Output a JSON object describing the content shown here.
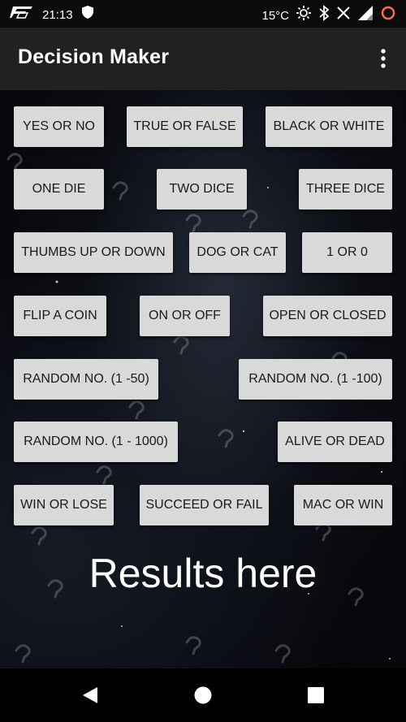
{
  "status_bar": {
    "time": "21:13",
    "temperature": "15°C",
    "icons": [
      "app-notification-icon",
      "shield-icon",
      "brightness-icon",
      "bluetooth-icon",
      "mute-icon",
      "signal-icon",
      "sync-icon"
    ]
  },
  "app_bar": {
    "title": "Decision Maker",
    "overflow_icon": "more-vert-icon"
  },
  "buttons": {
    "yes_no": "YES OR NO",
    "true_false": "TRUE OR FALSE",
    "black_white": "BLACK OR WHITE",
    "one_die": "ONE DIE",
    "two_dice": "TWO DICE",
    "three_dice": "THREE DICE",
    "thumbs": "THUMBS UP OR DOWN",
    "dog_cat": "DOG OR CAT",
    "one_zero": "1 OR 0",
    "flip_coin": "FLIP A COIN",
    "on_off": "ON OR OFF",
    "open_closed": "OPEN OR CLOSED",
    "random_50": "RANDOM NO. (1 -50)",
    "random_100": "RANDOM NO. (1 -100)",
    "random_1000": "RANDOM NO. (1 - 1000)",
    "alive_dead": "ALIVE OR DEAD",
    "win_lose": "WIN OR LOSE",
    "succeed_fail": "SUCCEED OR FAIL",
    "mac_win": "MAC OR WIN"
  },
  "results_text": "Results here",
  "nav_bar": {
    "icons": [
      "back-icon",
      "home-icon",
      "recents-icon"
    ]
  },
  "colors": {
    "button_bg": "#d9d9d9",
    "app_bar": "#212121",
    "status_bar": "#0b0b0b"
  }
}
